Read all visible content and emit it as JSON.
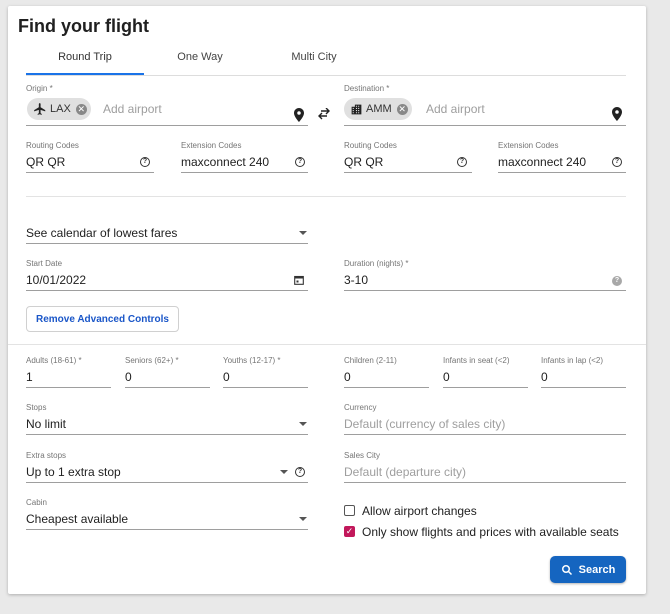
{
  "title": "Find your flight",
  "tabs": [
    {
      "label": "Round Trip"
    },
    {
      "label": "One Way"
    },
    {
      "label": "Multi City"
    }
  ],
  "origin": {
    "label": "Origin *",
    "chip": "LAX",
    "placeholder": "Add airport",
    "routing_label": "Routing Codes",
    "routing_value": "QR QR",
    "extension_label": "Extension Codes",
    "extension_value": "maxconnect 240"
  },
  "destination": {
    "label": "Destination *",
    "chip": "AMM",
    "placeholder": "Add airport",
    "routing_label": "Routing Codes",
    "routing_value": "QR QR",
    "extension_label": "Extension Codes",
    "extension_value": "maxconnect 240"
  },
  "calendar_select": "See calendar of lowest fares",
  "start_date": {
    "label": "Start Date",
    "value": "10/01/2022"
  },
  "duration": {
    "label": "Duration (nights) *",
    "value": "3-10"
  },
  "advanced_button": "Remove Advanced Controls",
  "passengers": [
    {
      "label": "Adults (18-61) *",
      "value": "1"
    },
    {
      "label": "Seniors (62+) *",
      "value": "0"
    },
    {
      "label": "Youths (12-17) *",
      "value": "0"
    },
    {
      "label": "Children (2-11)",
      "value": "0"
    },
    {
      "label": "Infants in seat (<2)",
      "value": "0"
    },
    {
      "label": "Infants in lap (<2)",
      "value": "0"
    }
  ],
  "stops": {
    "label": "Stops",
    "value": "No limit"
  },
  "currency": {
    "label": "Currency",
    "placeholder": "Default (currency of sales city)"
  },
  "extra_stops": {
    "label": "Extra stops",
    "value": "Up to 1 extra stop"
  },
  "sales_city": {
    "label": "Sales City",
    "placeholder": "Default (departure city)"
  },
  "cabin": {
    "label": "Cabin",
    "value": "Cheapest available"
  },
  "checkboxes": [
    {
      "label": "Allow airport changes",
      "checked": false
    },
    {
      "label": "Only show flights and prices with available seats",
      "checked": true
    }
  ],
  "search_button": "Search",
  "colors": {
    "accent": "#1a73e8",
    "button": "#1565c0",
    "checkbox": "#c2185b"
  },
  "icons": [
    "airplane-icon",
    "building-icon",
    "location-pin-icon",
    "swap-icon",
    "help-icon",
    "calendar-icon",
    "search-icon"
  ]
}
